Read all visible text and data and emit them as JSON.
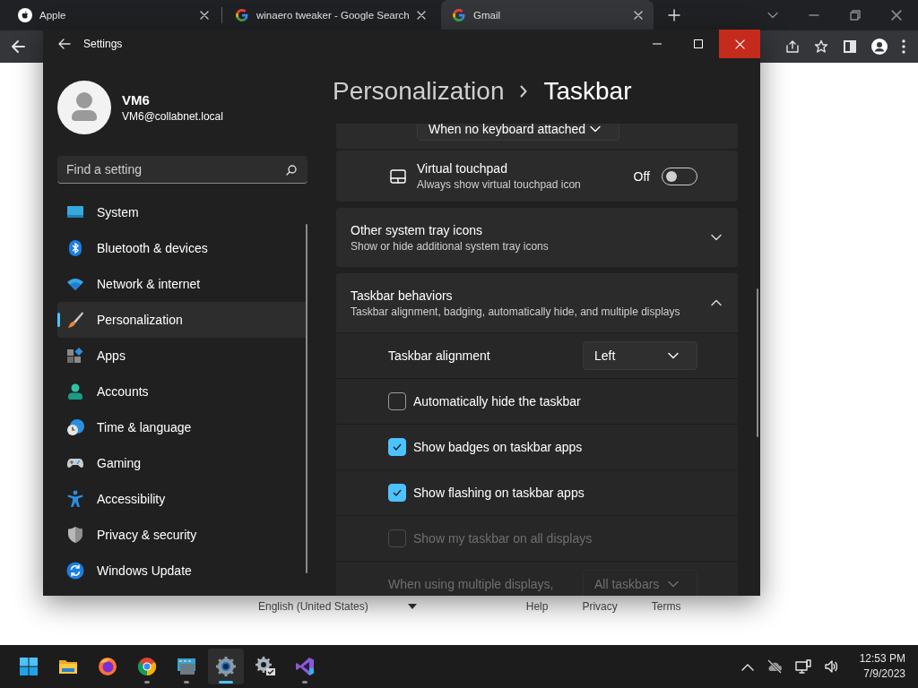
{
  "browser": {
    "tabs": [
      {
        "title": "Apple",
        "selected": false
      },
      {
        "title": "winaero tweaker - Google Search",
        "selected": false
      },
      {
        "title": "Gmail",
        "selected": true
      }
    ]
  },
  "page_footer": {
    "language": "English (United States)",
    "links": [
      "Help",
      "Privacy",
      "Terms"
    ]
  },
  "settings": {
    "title": "Settings",
    "user": {
      "name": "VM6",
      "email": "VM6@collabnet.local"
    },
    "search": {
      "placeholder": "Find a setting"
    },
    "nav": [
      {
        "label": "System",
        "selected": false
      },
      {
        "label": "Bluetooth & devices",
        "selected": false
      },
      {
        "label": "Network & internet",
        "selected": false
      },
      {
        "label": "Personalization",
        "selected": true
      },
      {
        "label": "Apps",
        "selected": false
      },
      {
        "label": "Accounts",
        "selected": false
      },
      {
        "label": "Time & language",
        "selected": false
      },
      {
        "label": "Gaming",
        "selected": false
      },
      {
        "label": "Accessibility",
        "selected": false
      },
      {
        "label": "Privacy & security",
        "selected": false
      },
      {
        "label": "Windows Update",
        "selected": false
      }
    ],
    "breadcrumb": {
      "parent": "Personalization",
      "current": "Taskbar"
    },
    "rows": [
      {
        "kind": "dropdown",
        "value": "When no keyboard attached"
      },
      {
        "kind": "toggle",
        "title": "Virtual touchpad",
        "description": "Always show virtual touchpad icon",
        "state_text": "Off",
        "on": false
      },
      {
        "kind": "expander",
        "title": "Other system tray icons",
        "description": "Show or hide additional system tray icons",
        "expanded": false
      },
      {
        "kind": "expander",
        "title": "Taskbar behaviors",
        "description": "Taskbar alignment, badging, automatically hide, and multiple displays",
        "expanded": true,
        "children": [
          {
            "kind": "dropdown",
            "label": "Taskbar alignment",
            "value": "Left",
            "disabled": false
          },
          {
            "kind": "checkbox",
            "label": "Automatically hide the taskbar",
            "checked": false,
            "disabled": false
          },
          {
            "kind": "checkbox",
            "label": "Show badges on taskbar apps",
            "checked": true,
            "disabled": false
          },
          {
            "kind": "checkbox",
            "label": "Show flashing on taskbar apps",
            "checked": true,
            "disabled": false
          },
          {
            "kind": "checkbox",
            "label": "Show my taskbar on all displays",
            "checked": false,
            "disabled": true
          },
          {
            "kind": "dropdown",
            "label": "When using multiple displays,",
            "value": "All taskbars",
            "disabled": true
          }
        ]
      }
    ]
  },
  "taskbar": {
    "apps": [
      {
        "running": false,
        "active": false
      },
      {
        "running": false,
        "active": false
      },
      {
        "running": false,
        "active": false
      },
      {
        "running": true,
        "active": false
      },
      {
        "running": true,
        "active": false
      },
      {
        "running": true,
        "active": true
      },
      {
        "running": false,
        "active": false
      },
      {
        "running": true,
        "active": false
      }
    ],
    "clock": {
      "time": "12:53 PM",
      "date": "7/9/2023"
    }
  }
}
